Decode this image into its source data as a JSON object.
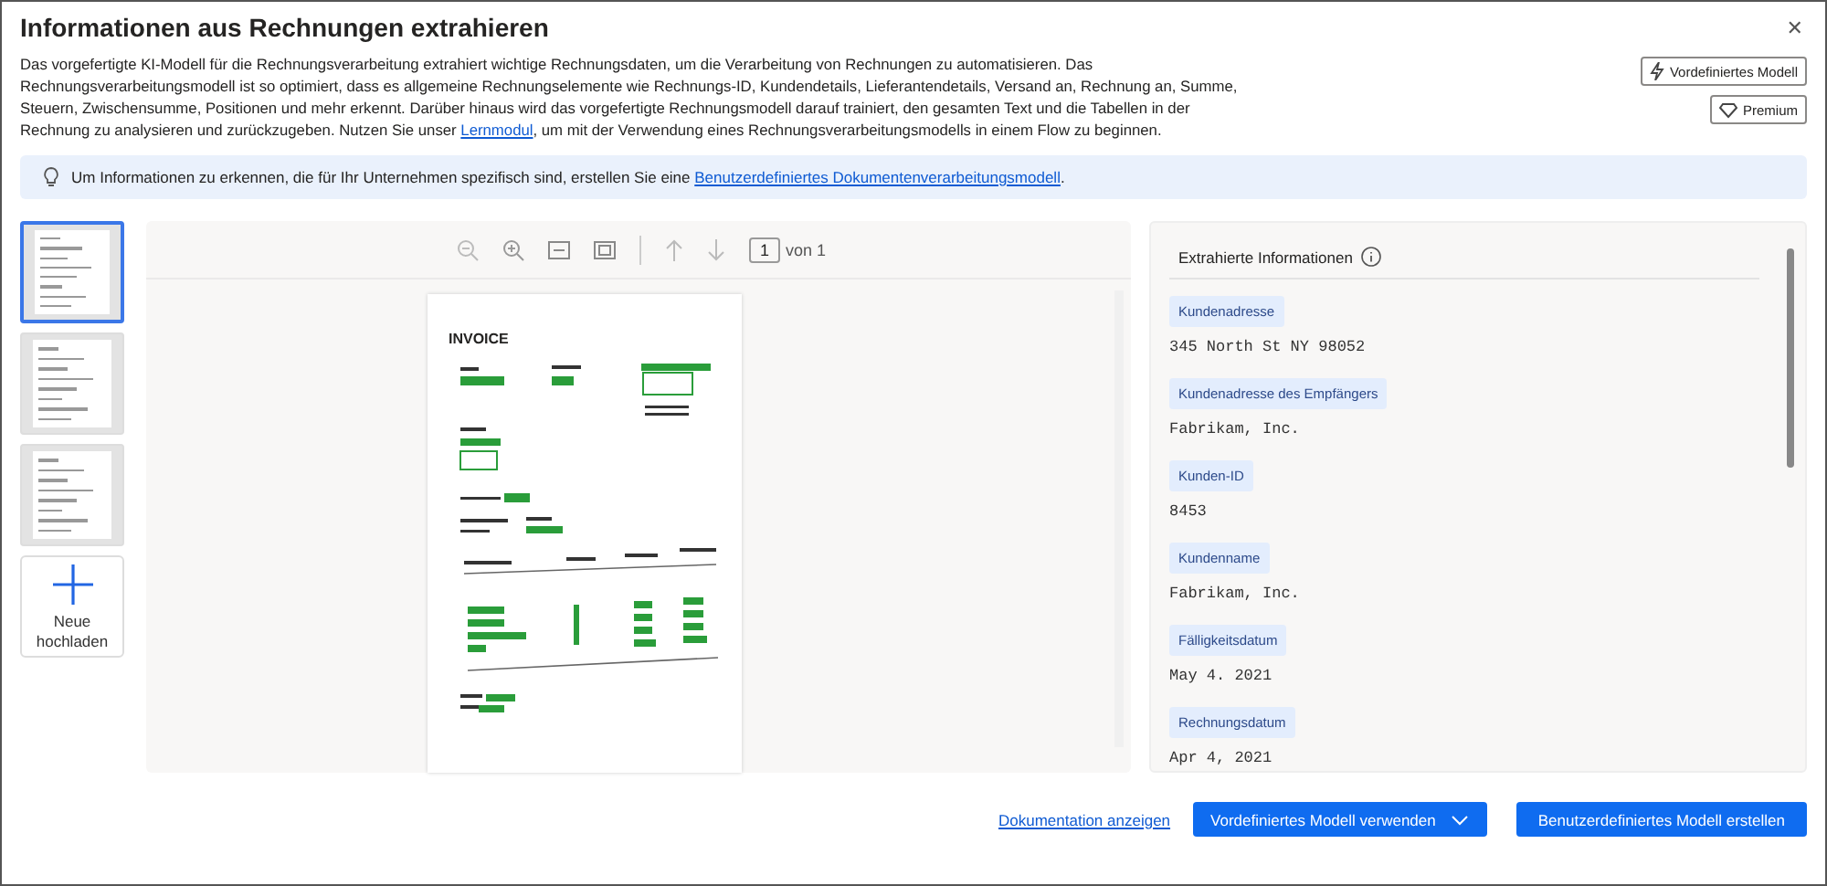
{
  "window": {
    "title": "Informationen aus Rechnungen extrahieren",
    "close": "✕"
  },
  "description": {
    "parts": [
      "Das vorgefertigte KI-Modell für die Rechnungsverarbeitung extrahiert wichtige Rechnungsdaten, um die Verarbeitung von Rechnungen zu automatisieren. Das Rechnungsverarbeitungsmodell ist so optimiert, dass es allgemeine Rechnungselemente wie Rechnungs-ID, Kundendetails, Lieferantendetails, Versand an, Rechnung an, Summe, Steuern, Zwischensumme, Positionen und mehr erkennt. Darüber hinaus wird das vorgefertigte Rechnungsmodell darauf trainiert, den gesamten Text und die Tabellen in der Rechnung zu analysieren und zurückzugeben. Nutzen Sie unser ",
      ", um mit der Verwendung eines Rechnungsverarbeitungsmodells in einem Flow zu beginnen."
    ],
    "link": "Lernmodul"
  },
  "badges": [
    {
      "kind": "prebuilt",
      "label": "Vordefiniertes Modell"
    },
    {
      "kind": "premium",
      "label": "Premium"
    }
  ],
  "banner": {
    "text": "Um Informationen zu erkennen, die für Ihr Unternehmen spezifisch sind, erstellen Sie eine ",
    "link": "Benutzerdefiniertes Dokumentenverarbeitungsmodell",
    "end": "."
  },
  "thumbnails": [
    {
      "selected": true
    },
    {
      "selected": false
    },
    {
      "selected": false
    }
  ],
  "upload": {
    "label": "Neue hochladen"
  },
  "viewer": {
    "page": "1",
    "page_total": "von 1",
    "document": {
      "heading": "INVOICE"
    }
  },
  "extracted": {
    "title": "Extrahierte Informationen",
    "fields": [
      {
        "label": "Kundenadresse",
        "value": "345 North St NY 98052"
      },
      {
        "label": "Kundenadresse des Empfängers",
        "value": "Fabrikam, Inc."
      },
      {
        "label": "Kunden-ID",
        "value": "8453"
      },
      {
        "label": "Kundenname",
        "value": "Fabrikam, Inc."
      },
      {
        "label": "Fälligkeitsdatum",
        "value": "May 4. 2021"
      },
      {
        "label": "Rechnungsdatum",
        "value": "Apr 4, 2021"
      }
    ]
  },
  "footer": {
    "link": "Dokumentation anzeigen",
    "buttons": [
      {
        "kind": "dropdown",
        "label": "Vordefiniertes Modell verwenden"
      },
      {
        "kind": "plain",
        "label": "Benutzerdefiniertes Modell erstellen"
      }
    ]
  }
}
